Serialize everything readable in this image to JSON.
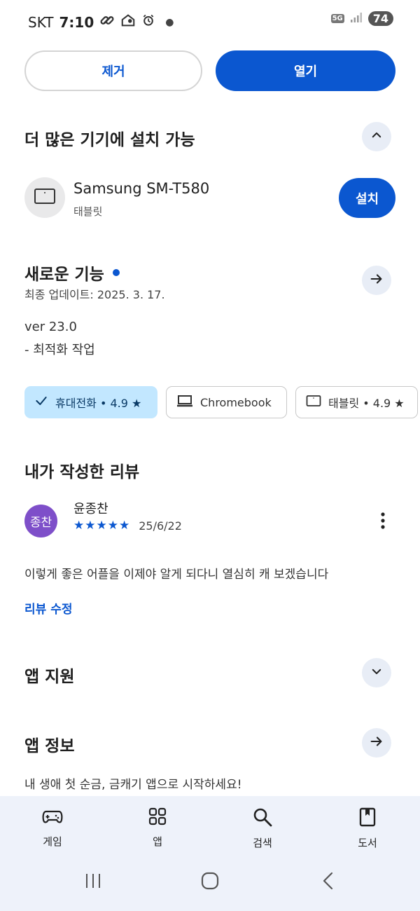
{
  "status": {
    "carrier": "SKT",
    "time": "7:10",
    "network": "5G",
    "battery": "74"
  },
  "actions": {
    "uninstall": "제거",
    "open": "열기"
  },
  "more_devices": {
    "title": "더 많은 기기에 설치 가능",
    "device_name": "Samsung SM-T580",
    "device_type": "태블릿",
    "install": "설치"
  },
  "whats_new": {
    "title": "새로운 기능",
    "updated": "최종 업데이트: 2025. 3. 17.",
    "version": "ver 23.0",
    "note": "- 최적화 작업"
  },
  "chips": [
    {
      "label": "휴대전화 • 4.9 ★",
      "selected": true
    },
    {
      "label": "Chromebook",
      "selected": false
    },
    {
      "label": "태블릿 • 4.9 ★",
      "selected": false
    }
  ],
  "my_review": {
    "title": "내가 작성한 리뷰",
    "avatar_text": "종찬",
    "author": "윤종찬",
    "stars": "★★★★★",
    "rating": 5,
    "date": "25/6/22",
    "body": "이렇게 좋은 어플을 이제야 알게 되다니 열심히 캐 보겠습니다",
    "edit": "리뷰 수정"
  },
  "app_support": {
    "title": "앱 지원"
  },
  "app_info": {
    "title": "앱 정보",
    "description": "내 생애 첫 순금, 금캐기 앱으로 시작하세요!"
  },
  "bottom_nav": {
    "games": "게임",
    "apps": "앱",
    "search": "검색",
    "books": "도서"
  },
  "colors": {
    "accent": "#0b57d0",
    "chip_selected": "#c2e7ff",
    "avatar": "#7e4fc9",
    "nav_bg": "#eef2fa"
  }
}
